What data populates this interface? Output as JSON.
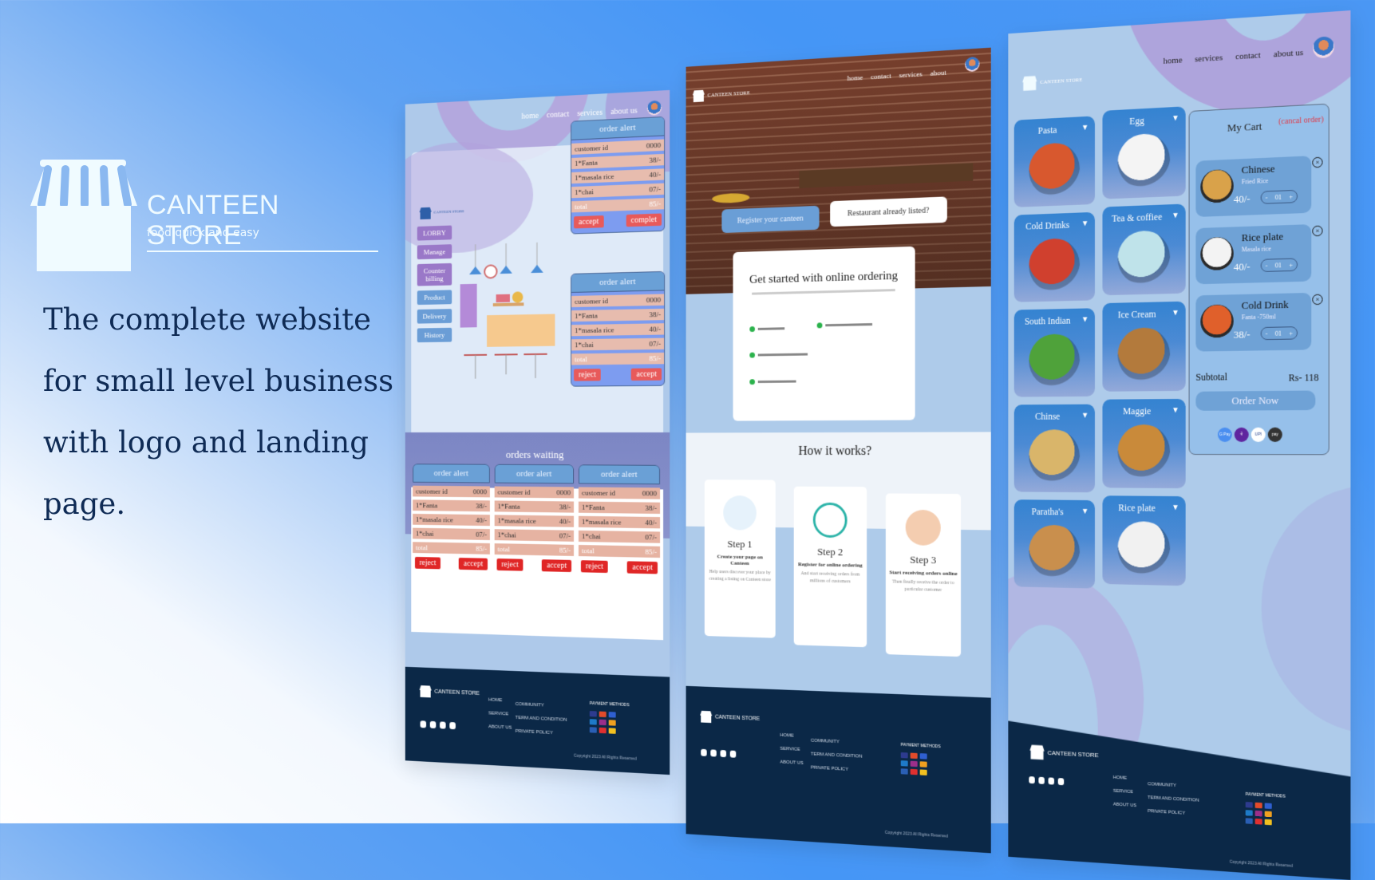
{
  "brand": {
    "name": "CANTEEN STORE",
    "tagline": "food quick and easy"
  },
  "headline": [
    "The complete website",
    "for small level business",
    "with logo and landing",
    "page."
  ],
  "admin": {
    "nav": [
      "home",
      "contact",
      "services",
      "about us"
    ],
    "sidebar": [
      {
        "label": "LOBBY",
        "style": "p"
      },
      {
        "label": "Manage",
        "style": "p"
      },
      {
        "label": "Counter billing",
        "style": "p"
      },
      {
        "label": "Product",
        "style": "b"
      },
      {
        "label": "Delivery",
        "style": "b"
      },
      {
        "label": "History",
        "style": "b"
      }
    ],
    "alerts": [
      {
        "title": "order alert",
        "rows": [
          [
            "customer id",
            "0000"
          ],
          [
            "1*Fanta",
            "38/-"
          ],
          [
            "1*masala rice",
            "40/-"
          ],
          [
            "1*chai",
            "07/-"
          ],
          [
            "total",
            "85/-"
          ]
        ],
        "buttons": [
          "accept",
          "complet"
        ]
      },
      {
        "title": "order alert",
        "rows": [
          [
            "customer id",
            "0000"
          ],
          [
            "1*Fanta",
            "38/-"
          ],
          [
            "1*masala rice",
            "40/-"
          ],
          [
            "1*chai",
            "07/-"
          ],
          [
            "total",
            "85/-"
          ]
        ],
        "buttons": [
          "reject",
          "accept"
        ]
      }
    ],
    "waiting": {
      "title": "orders waiting",
      "cards": [
        {
          "title": "order alert",
          "rows": [
            [
              "customer id",
              "0000"
            ],
            [
              "1*Fanta",
              "38/-"
            ],
            [
              "1*masala rice",
              "40/-"
            ],
            [
              "1*chai",
              "07/-"
            ],
            [
              "total",
              "85/-"
            ]
          ],
          "buttons": [
            "reject",
            "accept"
          ]
        },
        {
          "title": "order alert",
          "rows": [
            [
              "customer id",
              "0000"
            ],
            [
              "1*Fanta",
              "38/-"
            ],
            [
              "1*masala rice",
              "40/-"
            ],
            [
              "1*chai",
              "07/-"
            ],
            [
              "total",
              "85/-"
            ]
          ],
          "buttons": [
            "reject",
            "accept"
          ]
        },
        {
          "title": "order alert",
          "rows": [
            [
              "customer id",
              "0000"
            ],
            [
              "1*Fanta",
              "38/-"
            ],
            [
              "1*masala rice",
              "40/-"
            ],
            [
              "1*chai",
              "07/-"
            ],
            [
              "total",
              "85/-"
            ]
          ],
          "buttons": [
            "reject",
            "accept"
          ]
        }
      ]
    }
  },
  "landing": {
    "nav": [
      "home",
      "contact",
      "services",
      "about"
    ],
    "register_button": "Register your canteen",
    "listed_button": "Restaurant already listed?",
    "get_started_title": "Get started with online ordering",
    "how_title": "How it works?",
    "steps": [
      {
        "title": "Step 1",
        "subtitle": "Create your page on Canteen",
        "desc": "Help users discover your place by creating a listing on Canteen store"
      },
      {
        "title": "Step 2",
        "subtitle": "Register for online ordering",
        "desc": "And start receiving orders from millions of customers"
      },
      {
        "title": "Step 3",
        "subtitle": "Start receiving orders online",
        "desc": "Then finally receive the order to particular customer"
      }
    ]
  },
  "menu": {
    "nav": [
      "home",
      "services",
      "contact",
      "about us"
    ],
    "categories": [
      {
        "label": "Pasta",
        "color": "#d8582e"
      },
      {
        "label": "Egg",
        "color": "#f4f4f4"
      },
      {
        "label": "Cold Drinks",
        "color": "#d0402e"
      },
      {
        "label": "Tea & coffiee",
        "color": "#bfe3ea"
      },
      {
        "label": "South Indian",
        "color": "#4fa23a"
      },
      {
        "label": "Ice Cream",
        "color": "#b37a3c"
      },
      {
        "label": "Chinse",
        "color": "#d9b56a"
      },
      {
        "label": "Maggie",
        "color": "#c98a3a"
      },
      {
        "label": "Paratha's",
        "color": "#c98f4d"
      },
      {
        "label": "Rice plate",
        "color": "#f1f1f1"
      }
    ],
    "cart": {
      "title": "My Cart",
      "cancel": "(cancal order)",
      "items": [
        {
          "name": "Chinese",
          "sub": "Fried Rice",
          "price": "40/-",
          "qty": "01",
          "color": "#d9a24a"
        },
        {
          "name": "Rice plate",
          "sub": "Masala rice",
          "price": "40/-",
          "qty": "01",
          "color": "#f3f3f3"
        },
        {
          "name": "Cold Drink",
          "sub": "Fanta -750ml",
          "price": "38/-",
          "qty": "01",
          "color": "#e0602b"
        }
      ],
      "minus": "-",
      "plus": "+",
      "remove": "×",
      "subtotal_label": "Subtotal",
      "subtotal_value": "Rs- 118",
      "order_button": "Order Now",
      "payments": [
        {
          "label": "G Pay",
          "color": "#4a8ef0"
        },
        {
          "label": "पे",
          "color": "#5f259f"
        },
        {
          "label": "UPI",
          "color": "#ffffff"
        },
        {
          "label": "pay",
          "color": "#333333"
        }
      ]
    }
  },
  "footer": {
    "links1": [
      "HOME",
      "SERVICE",
      "ABOUT US"
    ],
    "links2": [
      "COMMUNITY",
      "TERM AND CONDITION",
      "PRIVATE POLICY"
    ],
    "payment_title": "PAYMENT METHODS",
    "copyright": "Copyright 2023 All Rights Reserved",
    "pay_colors": [
      "#2d3b8f",
      "#e24b2b",
      "#2f5fd0",
      "#1e7ac8",
      "#9b2f8a",
      "#f0a020",
      "#2a5fb5",
      "#e03030",
      "#f2c020"
    ]
  }
}
